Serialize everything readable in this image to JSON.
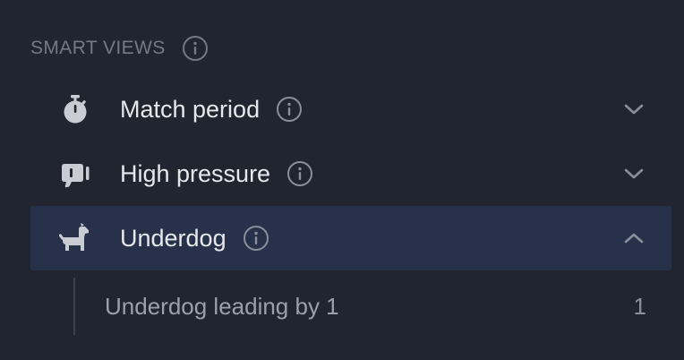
{
  "section": {
    "title": "SMART VIEWS",
    "info_icon": "info-circle-icon"
  },
  "items": [
    {
      "label": "Match period",
      "icon": "stopwatch-icon",
      "expanded": false,
      "chevron": "chevron-down-icon"
    },
    {
      "label": "High pressure",
      "icon": "pressure-gauge-icon",
      "expanded": false,
      "chevron": "chevron-down-icon"
    },
    {
      "label": "Underdog",
      "icon": "dog-icon",
      "expanded": true,
      "chevron": "chevron-up-icon",
      "children": [
        {
          "label": "Underdog leading by 1",
          "count": "1"
        }
      ]
    }
  ],
  "colors": {
    "background": "#21252f",
    "active_row": "#273149",
    "text_primary": "#e6e8ec",
    "text_muted": "#737a87",
    "icon": "#c9ccd2"
  }
}
